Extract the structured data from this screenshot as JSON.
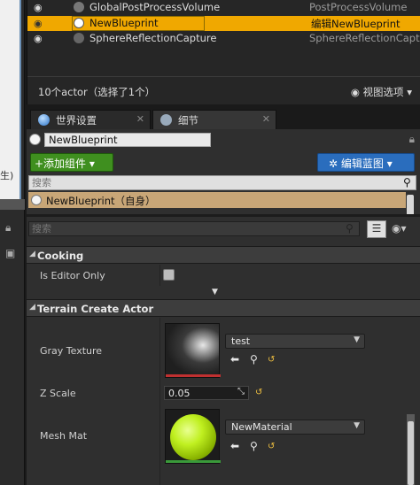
{
  "left_panel": {
    "fragment_text": "生)"
  },
  "outliner": {
    "rows": [
      {
        "name": "GlobalPostProcessVolume",
        "type": "PostProcessVolume",
        "selected": false
      },
      {
        "name": "NewBlueprint",
        "type": "编辑NewBlueprint",
        "selected": true
      },
      {
        "name": "SphereReflectionCapture",
        "type": "SphereReflectionCapture",
        "selected": false
      }
    ],
    "actor_count": "10个actor（选择了1个）",
    "view_options": "视图选项"
  },
  "tabs": [
    {
      "label": "世界设置",
      "active": false
    },
    {
      "label": "细节",
      "active": true
    }
  ],
  "details": {
    "actor_name": "NewBlueprint",
    "add_component": "+添加组件",
    "edit_blueprint": "编辑蓝图",
    "search_placeholder": "搜索",
    "component_row": "NewBlueprint（自身）",
    "search2_placeholder": "搜索",
    "categories": {
      "cooking": "Cooking",
      "terrain": "Terrain Create Actor"
    },
    "props": {
      "is_editor_only": "Is Editor Only",
      "gray_texture": "Gray Texture",
      "gray_texture_value": "test",
      "z_scale": "Z Scale",
      "z_scale_value": "0.05",
      "mesh_mat": "Mesh Mat",
      "mesh_mat_value": "NewMaterial"
    }
  },
  "colors": {
    "selection": "#f0a800",
    "add_button": "#3f8f1f",
    "edit_blueprint": "#2a6dbd",
    "component_row": "#c8a677",
    "reset_arrow": "#f0c040"
  },
  "icons": [
    "eye-icon",
    "actor-icon",
    "world-icon",
    "details-icon",
    "lock-icon",
    "search-icon",
    "grid-icon",
    "gear-icon",
    "arrow-left-icon",
    "browse-icon",
    "reset-icon"
  ]
}
